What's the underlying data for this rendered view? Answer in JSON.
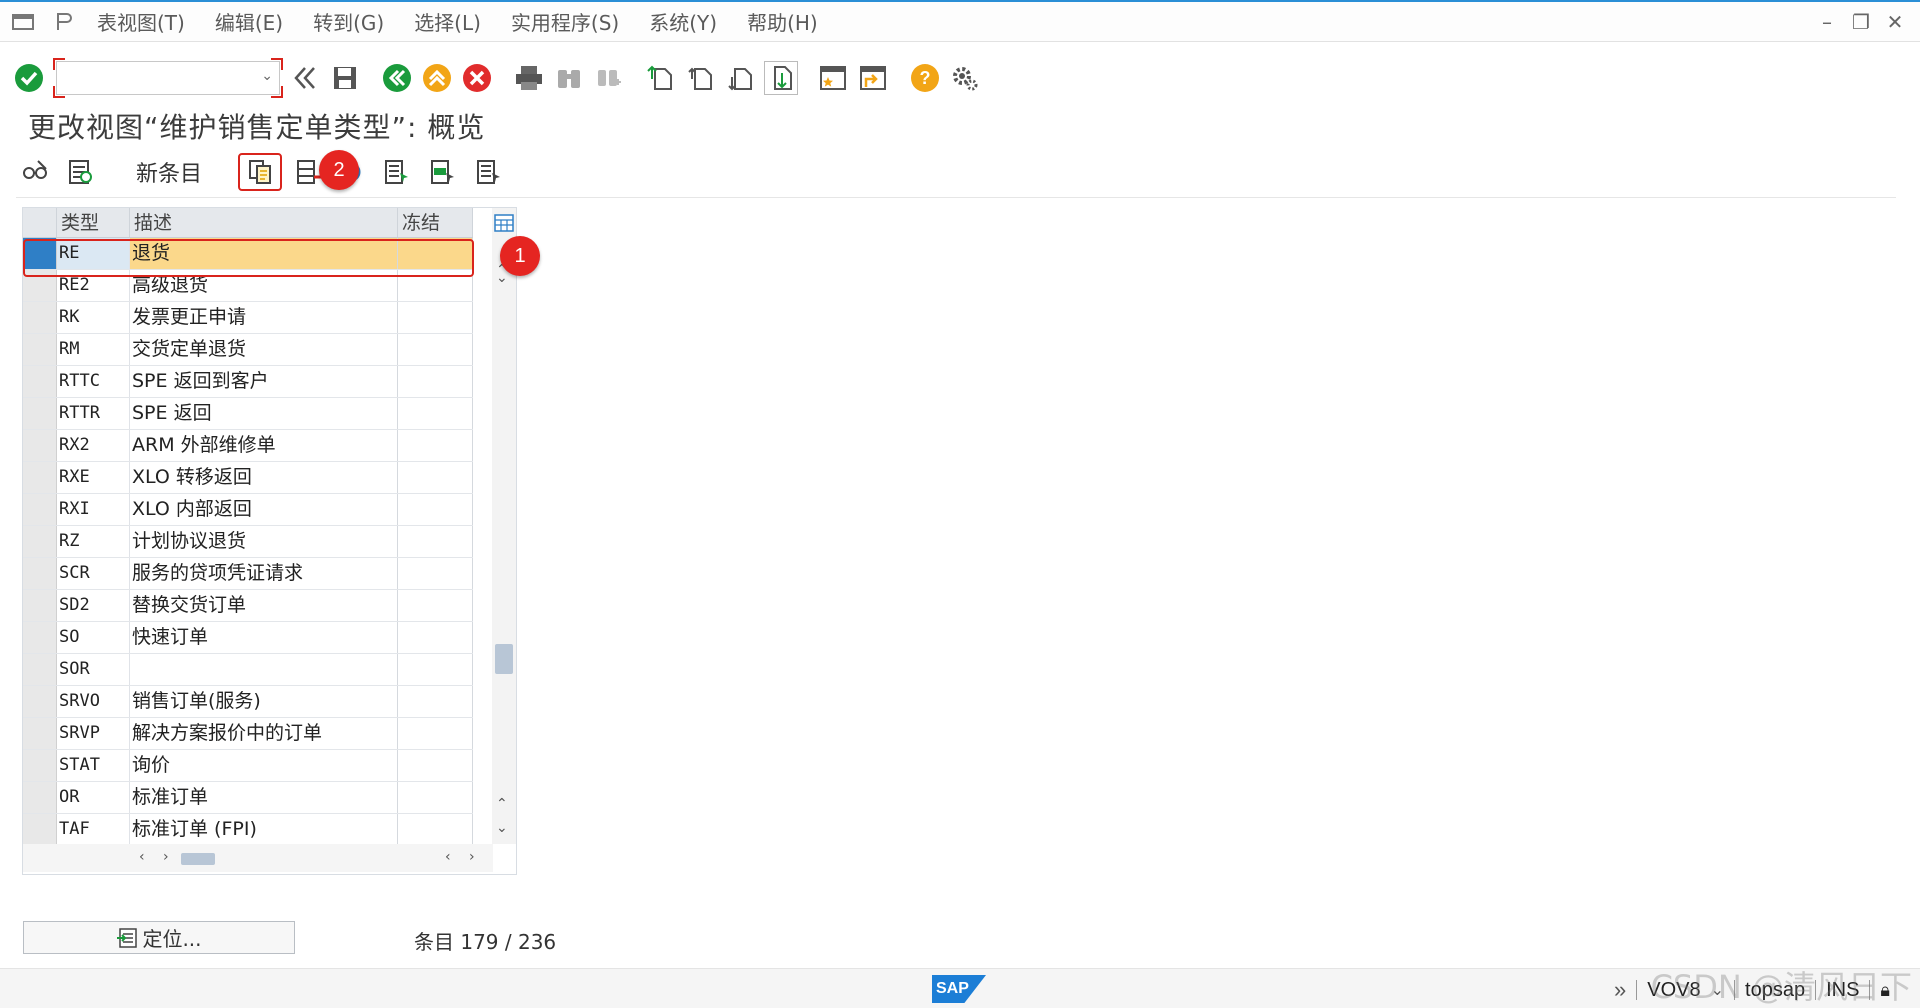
{
  "menu": {
    "items": [
      "表视图(T)",
      "编辑(E)",
      "转到(G)",
      "选择(L)",
      "实用程序(S)",
      "系统(Y)",
      "帮助(H)"
    ]
  },
  "toolbar": {
    "command_value": ""
  },
  "page": {
    "title": "更改视图“维护销售定单类型”: 概览"
  },
  "app_toolbar": {
    "new_entries_label": "新条目"
  },
  "table": {
    "columns": [
      "类型",
      "描述",
      "冻结"
    ],
    "rows": [
      {
        "type": "RE",
        "desc": "退货",
        "frozen": ""
      },
      {
        "type": "RE2",
        "desc": "高级退货",
        "frozen": ""
      },
      {
        "type": "RK",
        "desc": "发票更正申请",
        "frozen": ""
      },
      {
        "type": "RM",
        "desc": "交货定单退货",
        "frozen": ""
      },
      {
        "type": "RTTC",
        "desc": "SPE 返回到客户",
        "frozen": ""
      },
      {
        "type": "RTTR",
        "desc": "SPE 返回",
        "frozen": ""
      },
      {
        "type": "RX2",
        "desc": "ARM 外部维修单",
        "frozen": ""
      },
      {
        "type": "RXE",
        "desc": "XLO 转移返回",
        "frozen": ""
      },
      {
        "type": "RXI",
        "desc": "XLO 内部返回",
        "frozen": ""
      },
      {
        "type": "RZ",
        "desc": "计划协议退货",
        "frozen": ""
      },
      {
        "type": "SCR",
        "desc": "服务的贷项凭证请求",
        "frozen": ""
      },
      {
        "type": "SD2",
        "desc": "替换交货订单",
        "frozen": ""
      },
      {
        "type": "SO",
        "desc": "快速订单",
        "frozen": ""
      },
      {
        "type": "SOR",
        "desc": "",
        "frozen": ""
      },
      {
        "type": "SRVO",
        "desc": "销售订单(服务)",
        "frozen": ""
      },
      {
        "type": "SRVP",
        "desc": "解决方案报价中的订单",
        "frozen": ""
      },
      {
        "type": "STAT",
        "desc": "询价",
        "frozen": ""
      },
      {
        "type": "OR",
        "desc": "标准订单",
        "frozen": ""
      },
      {
        "type": "TAF",
        "desc": "标准订单 (FPI)",
        "frozen": ""
      }
    ],
    "selected_index": 0
  },
  "annotations": {
    "badge1": "1",
    "badge2": "2"
  },
  "footer": {
    "position_button": "定位...",
    "entry_count": "条目 179 / 236"
  },
  "status": {
    "logo": "SAP",
    "transaction": "VOV8",
    "server": "topsap",
    "mode": "INS"
  },
  "watermark": "CSDN @清风日下",
  "colors": {
    "accent_blue": "#2f7fc6",
    "selected_row": "#fbd88b",
    "highlight_red": "#d9241c",
    "green_ok": "#1a9b3c",
    "orange": "#f2a516"
  }
}
